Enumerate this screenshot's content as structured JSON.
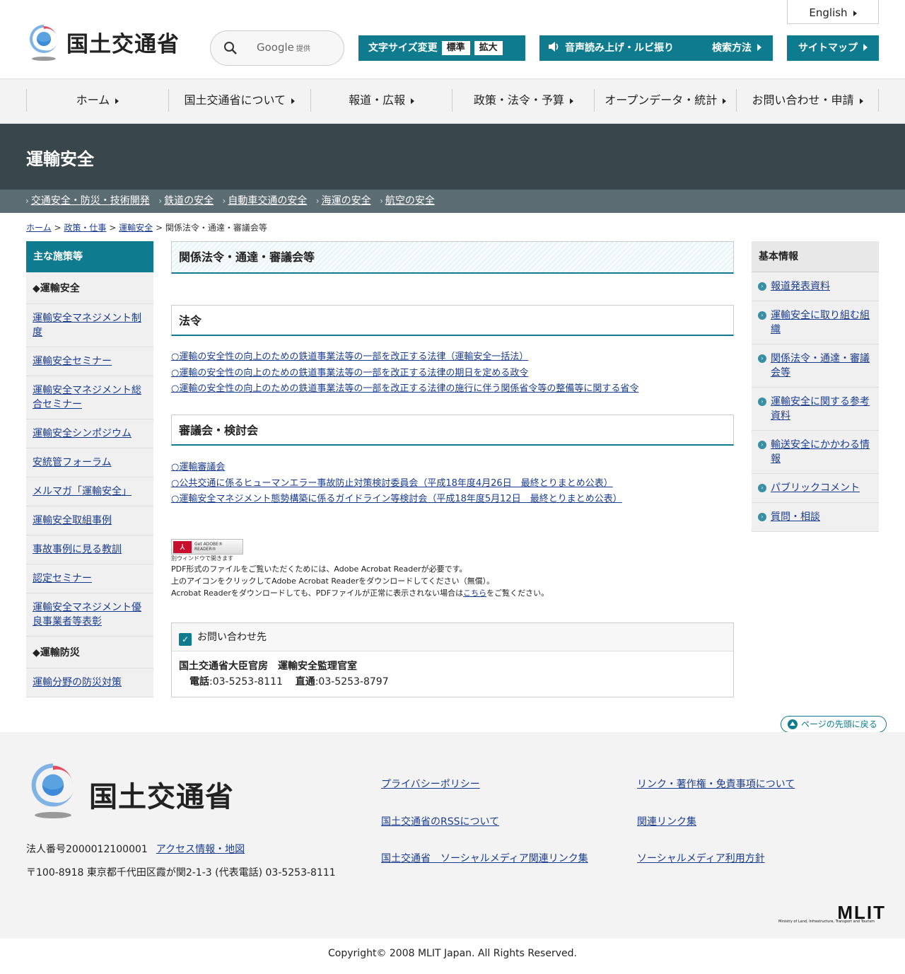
{
  "header": {
    "site_name": "国土交通省",
    "search_label": "Google",
    "search_suffix": "提供",
    "english_label": "English",
    "font_size_label": "文字サイズ変更",
    "font_size_normal": "標準",
    "font_size_large": "拡大",
    "voice_label": "音声読み上げ・ルビ振り",
    "search_method_label": "検索方法",
    "sitemap_label": "サイトマップ"
  },
  "gnav": {
    "items": [
      "ホーム",
      "国土交通省について",
      "報道・広報",
      "政策・法令・予算",
      "オープンデータ・統計",
      "お問い合わせ・申請"
    ]
  },
  "page": {
    "title": "運輸安全",
    "subnav": [
      "交通安全・防災・技術開発",
      "鉄道の安全",
      "自動車交通の安全",
      "海運の安全",
      "航空の安全"
    ],
    "breadcrumb": {
      "home": "ホーム",
      "policy": "政策・仕事",
      "section": "運輸安全",
      "current": "関係法令・通達・審議会等",
      "sep": ">"
    }
  },
  "left_sidebar": {
    "heading": "主な施策等",
    "section1": "◆運輸安全",
    "items1": [
      "運輸安全マネジメント制度",
      "運輸安全セミナー",
      "運輸安全マネジメント総合セミナー",
      "運輸安全シンポジウム",
      "安統管フォーラム",
      "メルマガ「運輸安全」",
      "運輸安全取組事例",
      "事故事例に見る教訓",
      "認定セミナー",
      "運輸安全マネジメント優良事業者等表彰"
    ],
    "section2": "◆運輸防災",
    "items2": [
      "運輸分野の防災対策"
    ]
  },
  "main": {
    "heading": "関係法令・通達・審議会等",
    "laws_heading": "法令",
    "laws": [
      "○運輸の安全性の向上のための鉄道事業法等の一部を改正する法律（運輸安全一括法）",
      "○運輸の安全性の向上のための鉄道事業法等の一部を改正する法律の期日を定める政令",
      "○運輸の安全性の向上のための鉄道事業法等の一部を改正する法律の施行に伴う関係省令等の整備等に関する省令"
    ],
    "council_heading": "審議会・検討会",
    "councils": [
      "○運輸審議会",
      "○公共交通に係るヒューマンエラー事故防止対策検討委員会（平成18年度4月26日　最終とりまとめ公表）",
      "○運輸安全マネジメント態勢構築に係るガイドライン等検討会（平成18年度5月12日　最終とりまとめ公表）"
    ],
    "pdf": {
      "badge": "Get ADOBE® READER®",
      "new_window": "別ウィンドウで開きます",
      "note1": "PDF形式のファイルをご覧いただくためには、Adobe Acrobat Readerが必要です。",
      "note2": "上のアイコンをクリックしてAdobe Acrobat Readerをダウンロードしてください（無償）。",
      "note3_pre": "Acrobat Readerをダウンロードしても、PDFファイルが正常に表示されない場合は",
      "note3_link": "こちら",
      "note3_post": "をご覧ください。"
    },
    "contact": {
      "heading": "お問い合わせ先",
      "org": "国土交通省大臣官房　運輸安全監理官室",
      "tel_label": "電話",
      "tel": ":03-5253-8111",
      "direct_label": "直通",
      "direct": ":03-5253-8797"
    }
  },
  "right_sidebar": {
    "heading": "基本情報",
    "items": [
      "報道発表資料",
      "運輸安全に取り組む組織",
      "関係法令・通達・審議会等",
      "運輸安全に関する参考資料",
      "輸送安全にかかわる情報",
      "パブリックコメント",
      "質問・相談"
    ]
  },
  "footer": {
    "back_to_top": "ページの先頭に戻る",
    "site_name": "国土交通省",
    "corp_number": "法人番号2000012100001",
    "access": "アクセス情報・地図",
    "address": "〒100-8918 東京都千代田区霞が関2-1-3 (代表電話) 03-5253-8111",
    "links": [
      "プライバシーポリシー",
      "リンク・著作権・免責事項について",
      "国土交通省のRSSについて",
      "関連リンク集",
      "国土交通省　ソーシャルメディア関連リンク集",
      "ソーシャルメディア利用方針"
    ],
    "mlit": "MLIT",
    "mlit_full": "Ministry of Land, Infrastructure, Transport and Tourism",
    "copyright": "Copyright© 2008 MLIT Japan. All Rights Reserved."
  }
}
